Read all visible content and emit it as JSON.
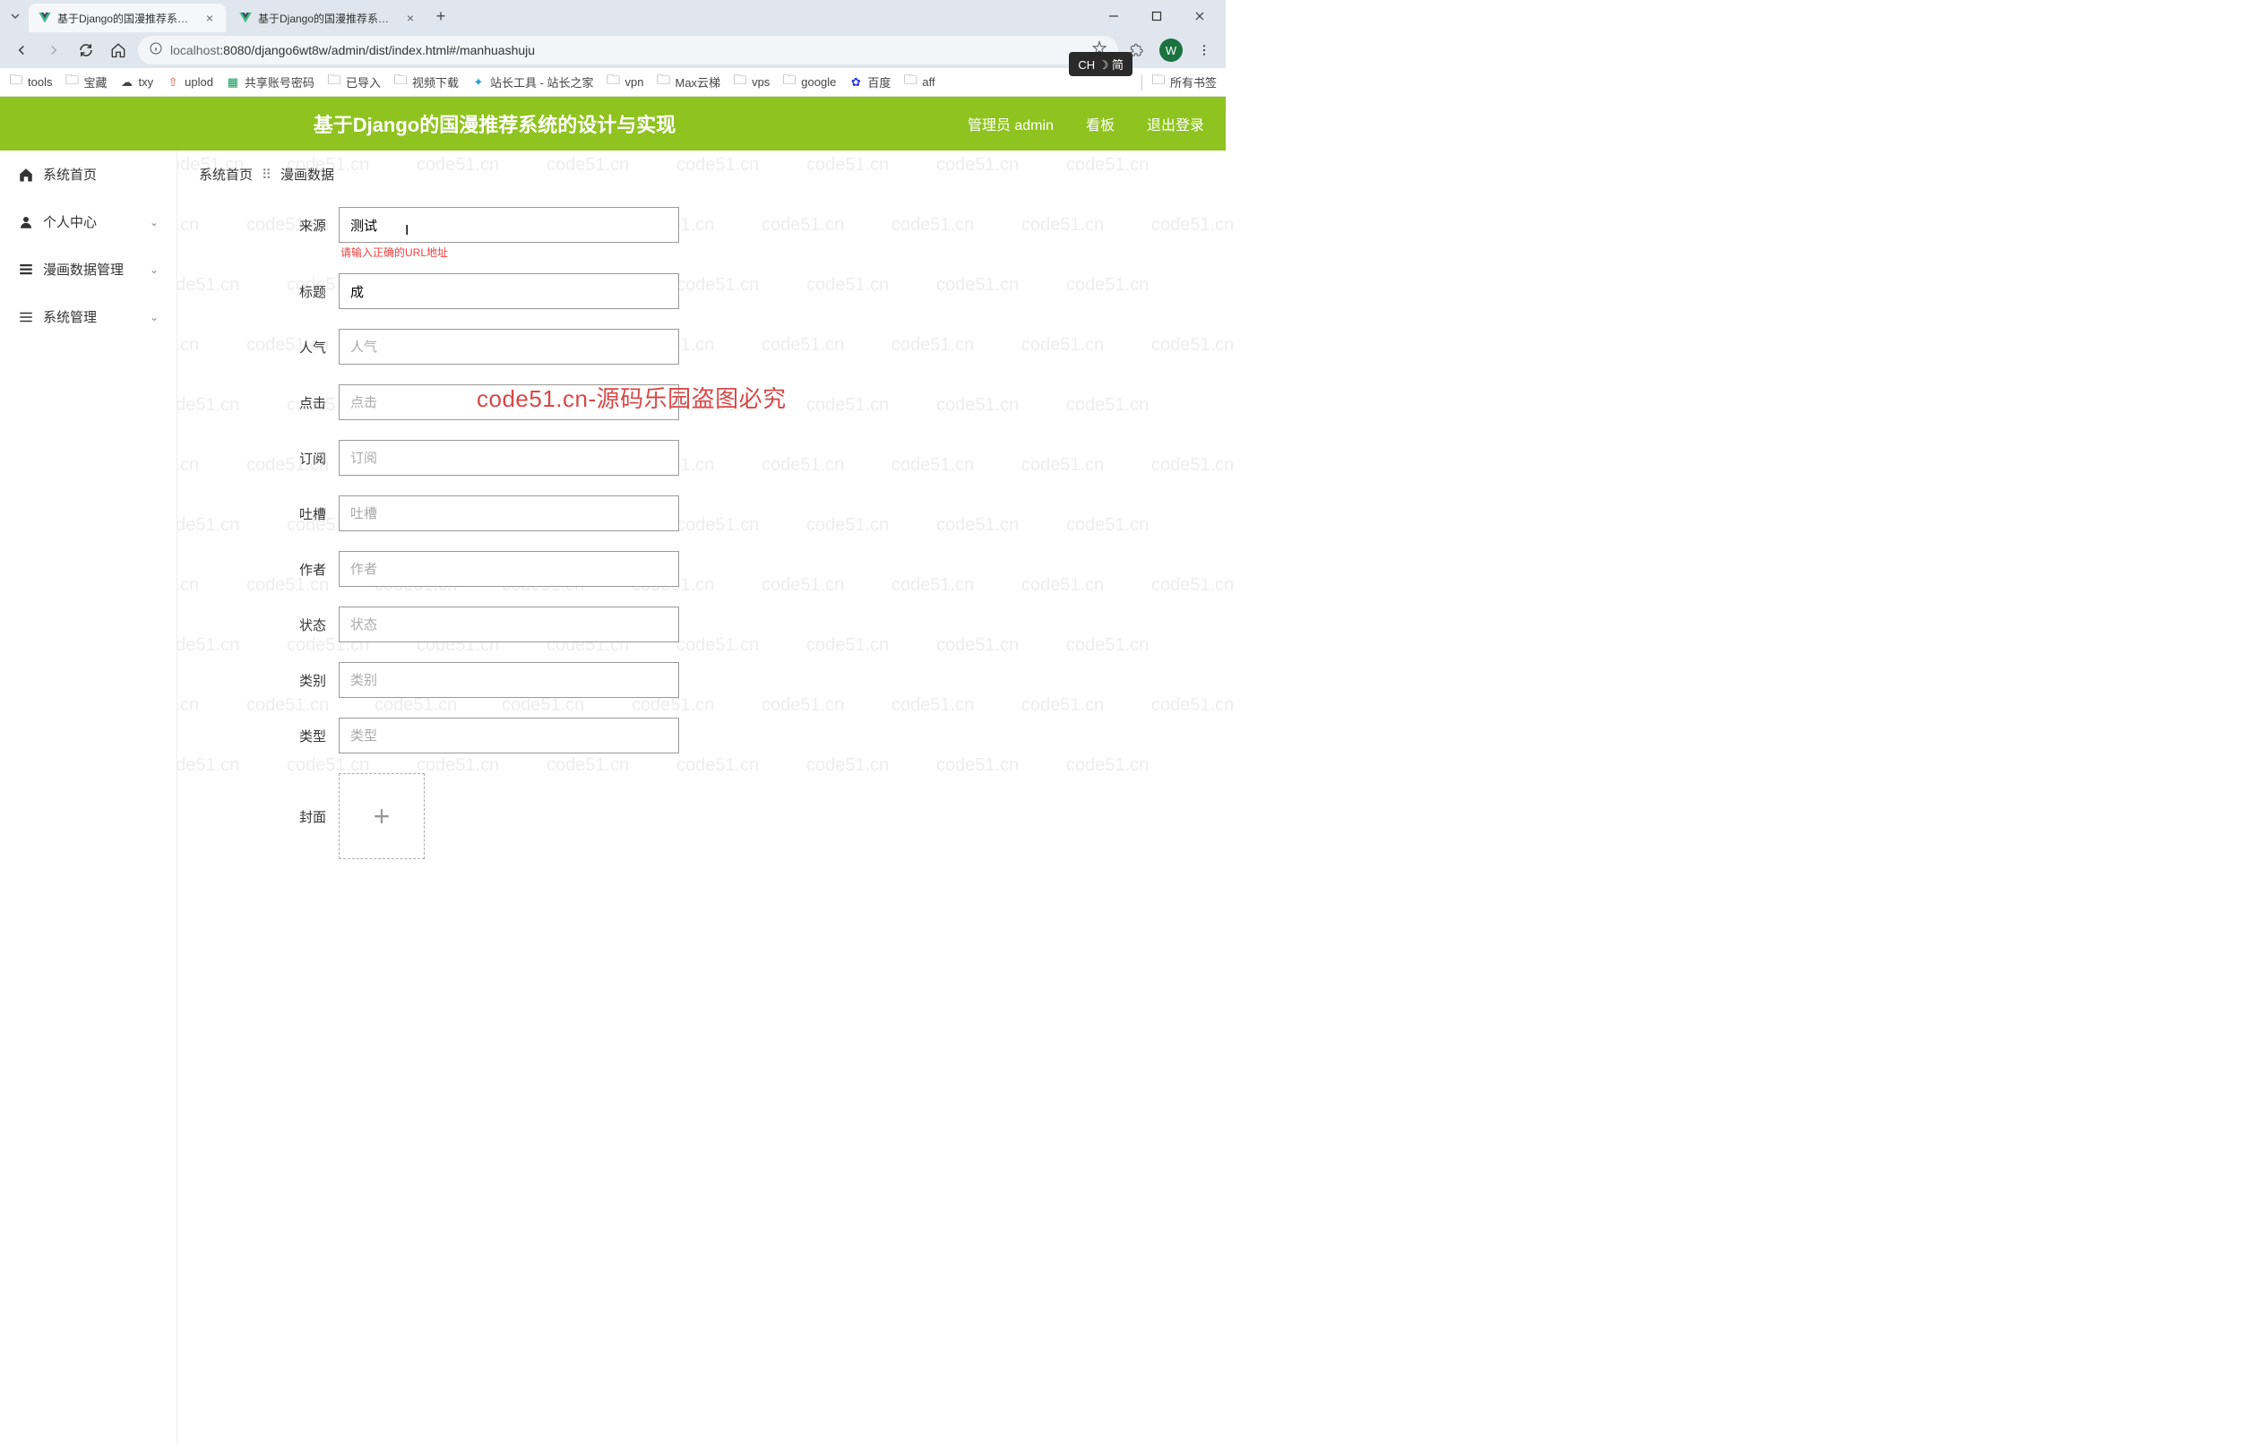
{
  "browser": {
    "tabs": [
      {
        "title": "基于Django的国漫推荐系统的...",
        "active": true
      },
      {
        "title": "基于Django的国漫推荐系统的...",
        "active": false
      }
    ],
    "url_host": "localhost",
    "url_path": ":8080/django6wt8w/admin/dist/index.html#/manhuashuju",
    "profile_letter": "W",
    "bookmarks": [
      {
        "label": "tools",
        "icon": "folder"
      },
      {
        "label": "宝藏",
        "icon": "folder"
      },
      {
        "label": "txy",
        "icon": "cloud"
      },
      {
        "label": "uplod",
        "icon": "upload"
      },
      {
        "label": "共享账号密码",
        "icon": "sheet"
      },
      {
        "label": "已导入",
        "icon": "folder"
      },
      {
        "label": "视频下载",
        "icon": "folder"
      },
      {
        "label": "站长工具 - 站长之家",
        "icon": "tool"
      },
      {
        "label": "vpn",
        "icon": "folder"
      },
      {
        "label": "Max云梯",
        "icon": "folder"
      },
      {
        "label": "vps",
        "icon": "folder"
      },
      {
        "label": "google",
        "icon": "folder"
      },
      {
        "label": "百度",
        "icon": "baidu"
      },
      {
        "label": "aff",
        "icon": "folder"
      }
    ],
    "all_bookmarks_label": "所有书签"
  },
  "ime": {
    "text": "CH ☽ 简"
  },
  "header": {
    "title": "基于Django的国漫推荐系统的设计与实现",
    "admin_label": "管理员 admin",
    "kanban_label": "看板",
    "logout_label": "退出登录"
  },
  "sidebar": {
    "items": [
      {
        "label": "系统首页",
        "icon": "home",
        "has_children": false
      },
      {
        "label": "个人中心",
        "icon": "person",
        "has_children": true
      },
      {
        "label": "漫画数据管理",
        "icon": "list",
        "has_children": true
      },
      {
        "label": "系统管理",
        "icon": "menu",
        "has_children": true
      }
    ]
  },
  "breadcrumb": {
    "home": "系统首页",
    "current": "漫画数据"
  },
  "form": {
    "fields": [
      {
        "label": "来源",
        "value": "测试",
        "placeholder": "",
        "error": "请输入正确的URL地址"
      },
      {
        "label": "标题",
        "value": "成",
        "placeholder": ""
      },
      {
        "label": "人气",
        "value": "",
        "placeholder": "人气"
      },
      {
        "label": "点击",
        "value": "",
        "placeholder": "点击"
      },
      {
        "label": "订阅",
        "value": "",
        "placeholder": "订阅"
      },
      {
        "label": "吐槽",
        "value": "",
        "placeholder": "吐槽"
      },
      {
        "label": "作者",
        "value": "",
        "placeholder": "作者"
      },
      {
        "label": "状态",
        "value": "",
        "placeholder": "状态"
      },
      {
        "label": "类别",
        "value": "",
        "placeholder": "类别"
      },
      {
        "label": "类型",
        "value": "",
        "placeholder": "类型"
      }
    ],
    "cover_label": "封面"
  },
  "watermark": {
    "text": "code51.cn",
    "center_text": "code51.cn-源码乐园盗图必究"
  }
}
